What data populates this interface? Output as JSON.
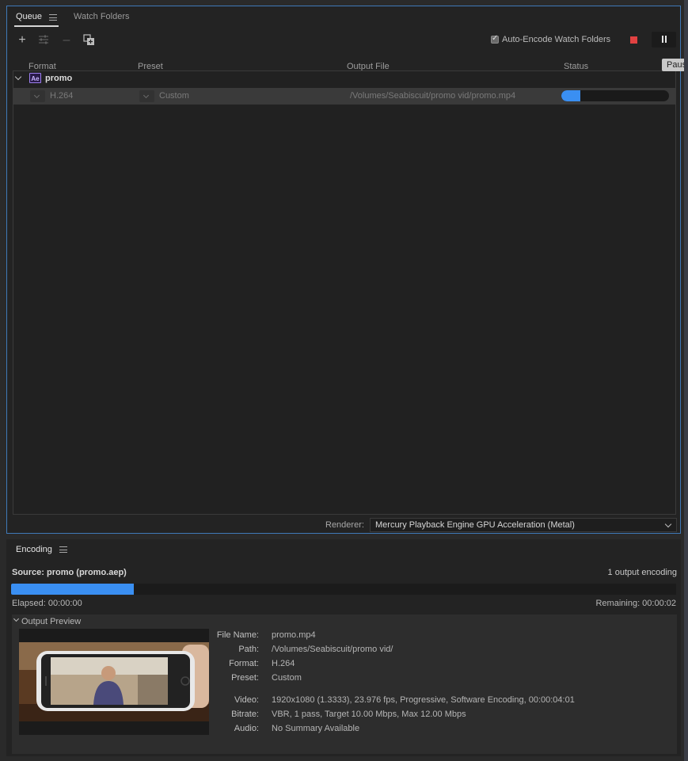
{
  "queue_panel": {
    "tabs": [
      {
        "label": "Queue"
      },
      {
        "label": "Watch Folders"
      }
    ],
    "auto_encode_label": "Auto-Encode Watch Folders",
    "tooltip": "Paus",
    "columns": {
      "format": "Format",
      "preset": "Preset",
      "output_file": "Output File",
      "status": "Status"
    },
    "group": {
      "badge": "Ae",
      "name": "promo"
    },
    "item": {
      "format": "H.264",
      "preset": "Custom",
      "output_file": "/Volumes/Seabiscuit/promo vid/promo.mp4",
      "progress_fraction": 0.18
    },
    "renderer_label": "Renderer:",
    "renderer_value": "Mercury Playback Engine GPU Acceleration (Metal)"
  },
  "encoding_panel": {
    "title": "Encoding",
    "source": "Source: promo (promo.aep)",
    "outputs": "1 output encoding",
    "progress_fraction": 0.185,
    "elapsed": "Elapsed: 00:00:00",
    "remaining": "Remaining: 00:00:02",
    "output_preview": {
      "title": "Output Preview",
      "details": [
        {
          "label": "File Name:",
          "value": "promo.mp4"
        },
        {
          "label": "Path:",
          "value": "/Volumes/Seabiscuit/promo vid/"
        },
        {
          "label": "Format:",
          "value": "H.264"
        },
        {
          "label": "Preset:",
          "value": "Custom"
        },
        {
          "label": "Video:",
          "value": "1920x1080 (1.3333), 23.976 fps, Progressive, Software Encoding, 00:00:04:01"
        },
        {
          "label": "Bitrate:",
          "value": "VBR, 1 pass, Target 10.00 Mbps, Max 12.00 Mbps"
        },
        {
          "label": "Audio:",
          "value": "No Summary Available"
        }
      ]
    }
  },
  "colors": {
    "accent": "#3a8ff2",
    "panel_border": "#3f79b8",
    "stop": "#e14141",
    "ae_badge": "#9d7ff0"
  }
}
